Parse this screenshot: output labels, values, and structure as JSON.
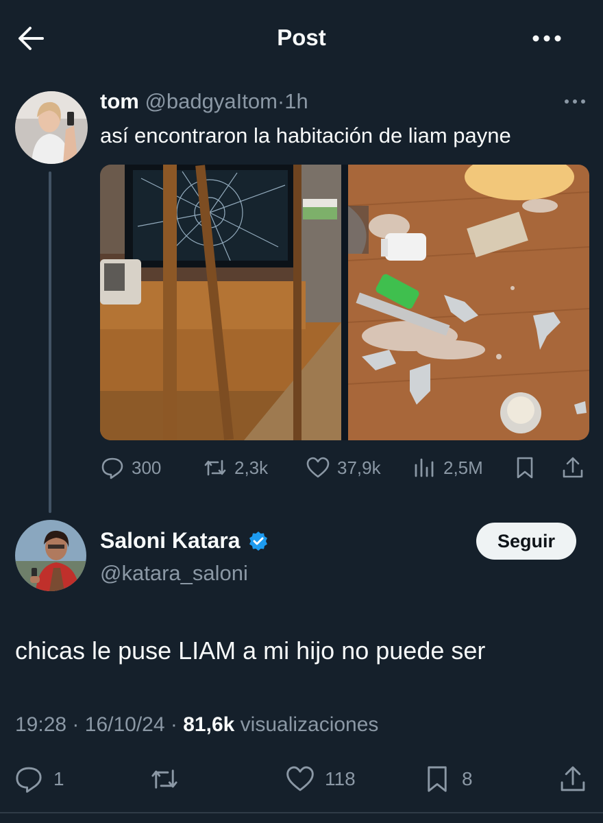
{
  "header": {
    "title": "Post"
  },
  "parent_post": {
    "name": "tom",
    "handle": "@badgyaItom",
    "separator": "·",
    "time": "1h",
    "text": "así encontraron la habitación de liam payne",
    "stats": {
      "replies": "300",
      "reposts": "2,3k",
      "likes": "37,9k",
      "views": "2,5M"
    }
  },
  "main_post": {
    "name": "Saloni Katara",
    "verified": true,
    "handle": "@katara_saloni",
    "follow_label": "Seguir",
    "text": "chicas le puse LIAM a mi hijo no puede ser",
    "time": "19:28",
    "date": "16/10/24",
    "sep1": "·",
    "sep2": "·",
    "views_count": "81,6k",
    "views_label": "visualizaciones",
    "stats": {
      "replies": "1",
      "likes": "118",
      "bookmarks": "8"
    }
  },
  "colors": {
    "background": "#15202b",
    "text": "#f7f9f9",
    "secondary_text": "#8b98a5",
    "verified": "#1d9bf0",
    "follow_button": "#eff3f4"
  }
}
